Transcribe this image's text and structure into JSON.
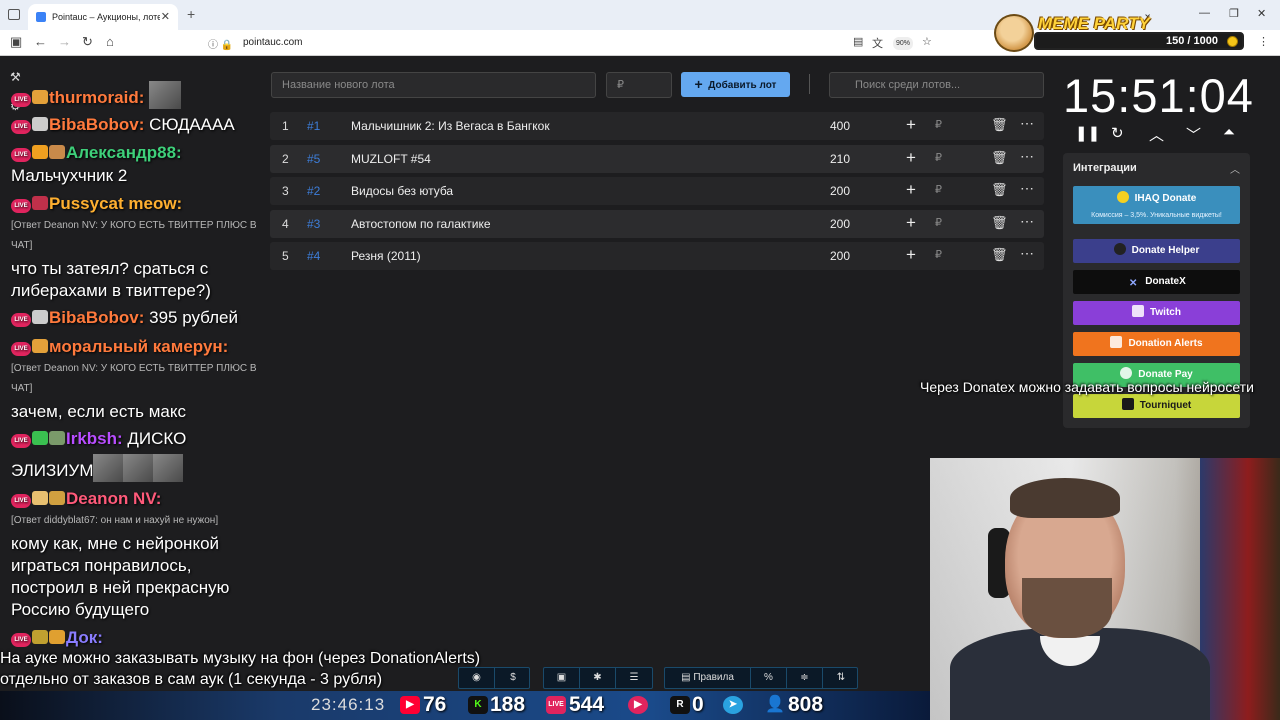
{
  "browser": {
    "tab_title": "Pointauc – Аукционы, лотереи",
    "url": "pointauc.com",
    "zoom": "90%"
  },
  "meme_party": {
    "title": "MEME PARTY",
    "counter": "150 / 1000"
  },
  "chat": {
    "messages": [
      {
        "nick": "thurmoraid:",
        "nick_color": "#ff7a3d",
        "text": ""
      },
      {
        "nick": "BibaBobov:",
        "nick_color": "#ff7a3d",
        "text": "СЮДАААА"
      },
      {
        "nick": "Александр88:",
        "nick_color": "#3ed07a",
        "text": ""
      },
      {
        "nick": "",
        "text": "Мальчухчник 2"
      },
      {
        "nick": "Pussycat meow:",
        "nick_color": "#ffb030",
        "text": ""
      },
      {
        "nick": "BibaBobov:",
        "nick_color": "#ff7a3d",
        "text": "395 рублей"
      },
      {
        "nick": "моральный камерун:",
        "nick_color": "#ff7a3d",
        "text": ""
      },
      {
        "nick": "Irkbsh:",
        "nick_color": "#b84dff",
        "text": "ДИСКО"
      },
      {
        "nick": "Deanon NV:",
        "nick_color": "#ff5a7a",
        "text": ""
      },
      {
        "nick": "Док:",
        "nick_color": "#8a7dff",
        "text": ""
      }
    ],
    "reply1": "[Ответ Deanon NV: У КОГО ЕСТЬ ТВИТТЕР ПЛЮС В ЧАТ]",
    "msg1": "что ты затеял? сраться с либерахами в твиттере?)",
    "reply2": "[Ответ Deanon NV: У КОГО ЕСТЬ ТВИТТЕР ПЛЮС В ЧАТ]",
    "msg2": "зачем, если есть макс",
    "msg3": "ЭЛИЗИУМ",
    "reply3": "[Ответ diddyblat67: он нам и нахуй не нужон]",
    "msg4": "кому как, мне с нейронкой играться понравилось, построил в ней прекрасную Россию будущего"
  },
  "auction": {
    "lot_placeholder": "Название нового лота",
    "price_placeholder": "₽",
    "add_button": "Добавить лот",
    "search_placeholder": "Поиск среди лотов...",
    "lots": [
      {
        "idx": "1",
        "hash": "#1",
        "name": "Мальчишник 2: Из Вегаса в Бангкок",
        "amount": "400"
      },
      {
        "idx": "2",
        "hash": "#5",
        "name": "MUZLOFT #54",
        "amount": "210"
      },
      {
        "idx": "3",
        "hash": "#2",
        "name": "Видосы без ютуба",
        "amount": "200"
      },
      {
        "idx": "4",
        "hash": "#3",
        "name": "Автостопом по галактике",
        "amount": "200"
      },
      {
        "idx": "5",
        "hash": "#4",
        "name": "Резня (2011)",
        "amount": "200"
      }
    ],
    "rub_symbol": "₽"
  },
  "timer": {
    "time": "15:51:04"
  },
  "integrations": {
    "header": "Интеграции",
    "ihaq_title": "IHAQ Donate",
    "ihaq_sub": "Комиссия – 3,5%. Уникальные виджеты!",
    "buttons": [
      {
        "label": "Donate Helper",
        "color": "#3b3f8c"
      },
      {
        "label": "DonateX",
        "color": "#0d0d0d"
      },
      {
        "label": "Twitch",
        "color": "#8a3fd8"
      },
      {
        "label": "Donation Alerts",
        "color": "#f0741e"
      },
      {
        "label": "Donate Pay",
        "color": "#3fbf66"
      },
      {
        "label": "Tourniquet",
        "color": "#c7d63a"
      }
    ]
  },
  "overlay": {
    "donatex_note": "Через Donatex можно задавать вопросы нейросети",
    "caption_line1": "На ауке можно заказывать музыку на фон (через DonationAlerts)",
    "caption_line2": "отдельно от заказов в сам аук (1 секунда - 3 рубля)",
    "rules_button": "Правила"
  },
  "stats": {
    "clock": "23:46:13",
    "youtube": "76",
    "kick": "188",
    "vk_live": "544",
    "rumble": "0",
    "telegram": "808"
  }
}
